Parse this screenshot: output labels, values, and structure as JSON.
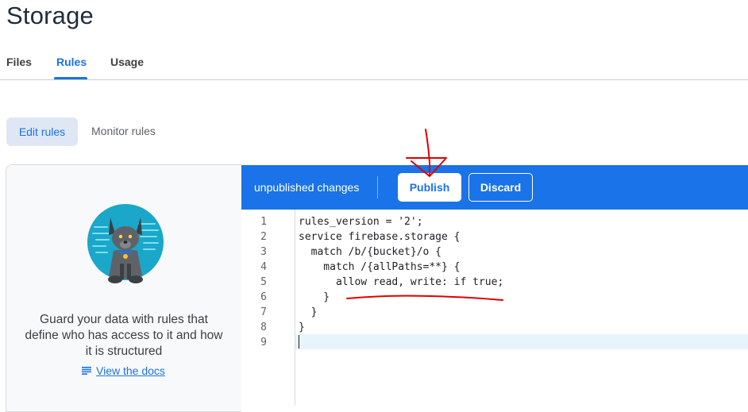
{
  "page": {
    "title": "Storage"
  },
  "tabs": [
    {
      "label": "Files",
      "active": false
    },
    {
      "label": "Rules",
      "active": true
    },
    {
      "label": "Usage",
      "active": false
    }
  ],
  "rules_nav": {
    "edit_label": "Edit rules",
    "monitor_label": "Monitor rules"
  },
  "left_panel": {
    "illustration": "dog-mascot",
    "message": "Guard your data with rules that define who has access to it and how it is structured",
    "docs_link": "View the docs",
    "docs_icon": "notes-lines-icon"
  },
  "editor": {
    "status": "unpublished changes",
    "publish_label": "Publish",
    "discard_label": "Discard",
    "line_numbers": [
      "1",
      "2",
      "3",
      "4",
      "5",
      "6",
      "7",
      "8",
      "9"
    ],
    "lines": [
      "rules_version = '2';",
      "service firebase.storage {",
      "  match /b/{bucket}/o {",
      "    match /{allPaths=**} {",
      "      allow read, write: if true;",
      "    }",
      "  }",
      "}",
      ""
    ]
  },
  "colors": {
    "accent": "#1a73e8",
    "annotation": "#e00000"
  }
}
